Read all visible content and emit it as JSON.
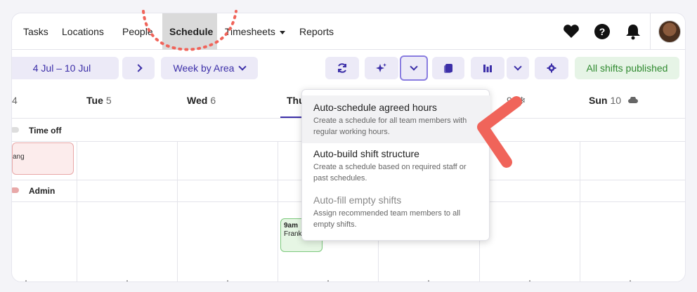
{
  "nav": {
    "items": [
      "Tasks",
      "Locations",
      "People",
      "Schedule",
      "Timesheets",
      "Reports"
    ],
    "active": "Schedule"
  },
  "toolbar": {
    "date_range": "4 Jul – 10 Jul",
    "view_select": "Week by Area",
    "published_label": "All shifts published"
  },
  "days": [
    {
      "name": "",
      "num": "4"
    },
    {
      "name": "Tue",
      "num": "5"
    },
    {
      "name": "Wed",
      "num": "6"
    },
    {
      "name": "Thu",
      "num": ""
    },
    {
      "name": "",
      "num": "9"
    },
    {
      "name": "Sun",
      "num": "10"
    }
  ],
  "groups": {
    "time_off": "Time off",
    "admin": "Admin"
  },
  "shifts": {
    "time_off_text": "ang",
    "admin_time": "9am",
    "admin_name": "Frank"
  },
  "dropdown": {
    "items": [
      {
        "title": "Auto-schedule agreed hours",
        "desc": "Create a schedule for all team members with regular working hours."
      },
      {
        "title": "Auto-build shift structure",
        "desc": "Create a schedule based on required staff or past schedules."
      },
      {
        "title": "Auto-fill empty shifts",
        "desc": "Assign recommended team members to all empty shifts."
      }
    ]
  },
  "colors": {
    "accent": "#3c2fa8",
    "published_green": "#2f8a2f",
    "annotation_red": "#f0645a"
  },
  "icons": [
    "refresh-icon",
    "sparkle-icon",
    "chevron-down-icon",
    "copy-icon",
    "chart-icon",
    "gear-icon",
    "heart-icon",
    "help-icon",
    "bell-icon",
    "cloud-icon",
    "snowflake-icon"
  ]
}
